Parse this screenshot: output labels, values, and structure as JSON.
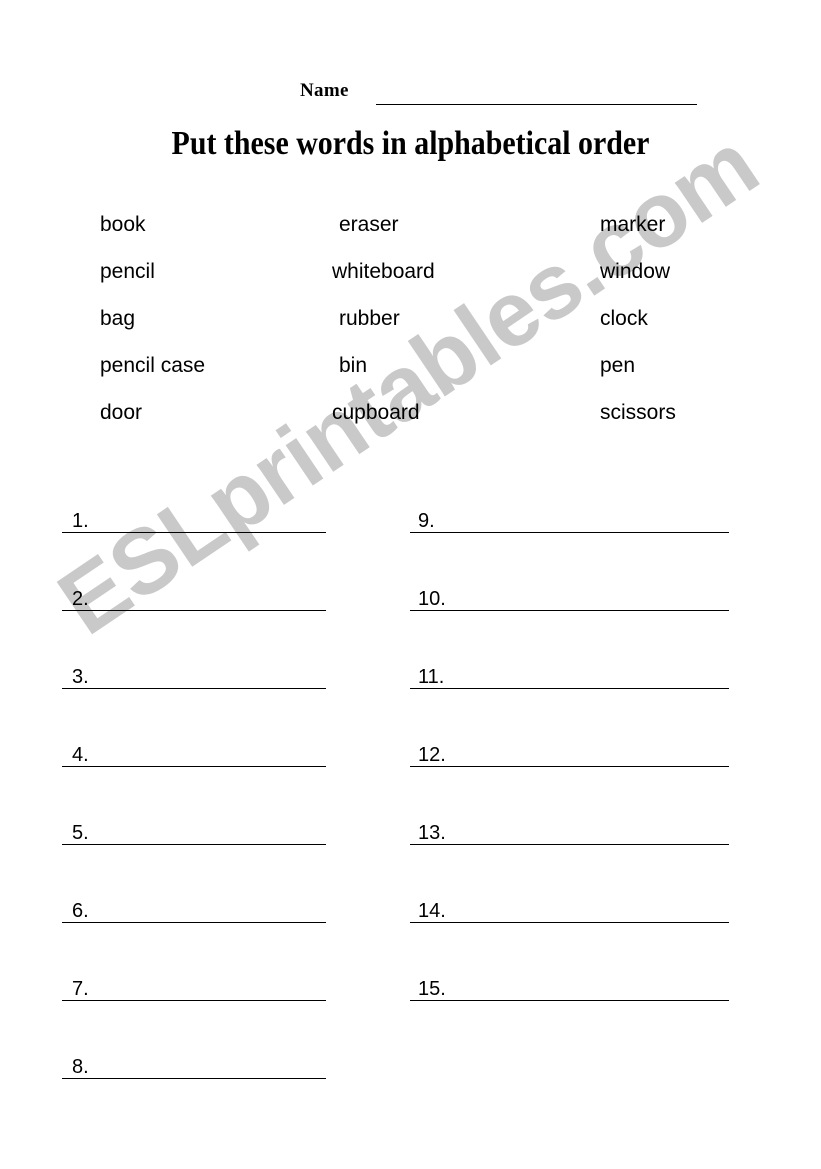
{
  "header": {
    "name_label": "Name",
    "name_value": ""
  },
  "title": "Put these words in alphabetical order",
  "word_bank": {
    "columns": 3,
    "rows": [
      {
        "col1": "book",
        "col2": "eraser",
        "col3": "marker"
      },
      {
        "col1": "pencil",
        "col2": "whiteboard",
        "col3": "window"
      },
      {
        "col1": "bag",
        "col2": "rubber",
        "col3": "clock"
      },
      {
        "col1": "pencil case",
        "col2": "bin",
        "col3": "pen"
      },
      {
        "col1": "door",
        "col2": "cupboard",
        "col3": "scissors"
      }
    ],
    "all_words": [
      "book",
      "eraser",
      "marker",
      "pencil",
      "whiteboard",
      "window",
      "bag",
      "rubber",
      "clock",
      "pencil case",
      "bin",
      "pen",
      "door",
      "cupboard",
      "scissors"
    ]
  },
  "answers": {
    "left_column": [
      "1.",
      "2.",
      "3.",
      "4.",
      "5.",
      "6.",
      "7.",
      "8."
    ],
    "right_column": [
      "9.",
      "10.",
      "11.",
      "12.",
      "13.",
      "14.",
      "15."
    ],
    "values": [
      "",
      "",
      "",
      "",
      "",
      "",
      "",
      "",
      "",
      "",
      "",
      "",
      "",
      "",
      ""
    ]
  },
  "watermark": {
    "text": "ESLprintables.com",
    "color": "#c9c9c9"
  }
}
